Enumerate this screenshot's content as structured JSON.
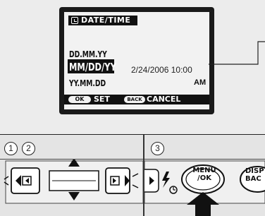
{
  "screen": {
    "header_title": "DATE/TIME",
    "formats": [
      "DD.MM.YY",
      "MM/DD/YY",
      "YY.MM.DD"
    ],
    "selected_format": "MM/DD/YY",
    "date_time": "2/24/2006 10:00",
    "ampm": "AM",
    "footer": {
      "ok_chip": "OK",
      "set_label": "SET",
      "back_chip": "BACK",
      "cancel_label": "CANCEL"
    }
  },
  "steps": {
    "step1": "1",
    "step2": "2",
    "step3": "3"
  },
  "buttons": {
    "menu_ok_line1": "MENU",
    "menu_ok_line2": "/OK",
    "disp_back_line1": "DISP",
    "disp_back_line2": "BAC"
  },
  "icons": [
    "calendar-clock-icon",
    "left-arrow-icon",
    "right-arrow-icon",
    "up-arrow-icon",
    "down-arrow-icon",
    "flash-icon",
    "self-timer-icon",
    "pointing-arrow-icon"
  ],
  "colors": {
    "lcd_bg": "#f2f2f2",
    "lcd_bar": "#111111",
    "panel_bg": "#e4e4e4"
  }
}
